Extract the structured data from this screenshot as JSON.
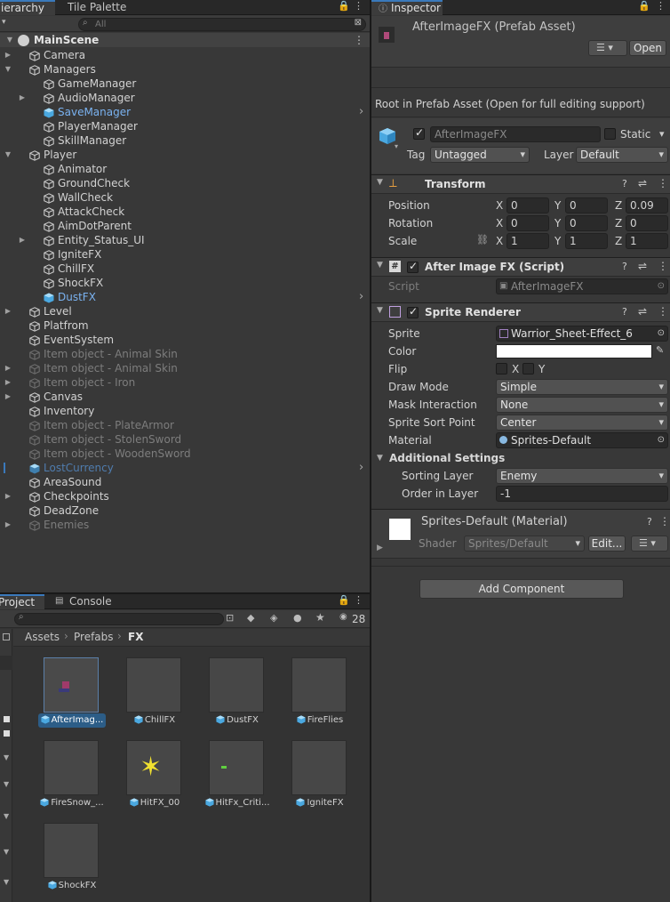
{
  "hierarchy": {
    "tabs": [
      "Hierarchy",
      "Tile Palette"
    ],
    "search_placeholder": "All",
    "scene": "MainScene",
    "items": [
      {
        "label": "Camera",
        "depth": 1,
        "fold": "closed",
        "style": "normal"
      },
      {
        "label": "Managers",
        "depth": 1,
        "fold": "open",
        "style": "normal"
      },
      {
        "label": "GameManager",
        "depth": 2,
        "fold": "none",
        "style": "normal"
      },
      {
        "label": "AudioManager",
        "depth": 2,
        "fold": "closed",
        "style": "normal"
      },
      {
        "label": "SaveManager",
        "depth": 2,
        "fold": "none",
        "style": "prefab",
        "arrow": true
      },
      {
        "label": "PlayerManager",
        "depth": 2,
        "fold": "none",
        "style": "normal"
      },
      {
        "label": "SkillManager",
        "depth": 2,
        "fold": "none",
        "style": "normal"
      },
      {
        "label": "Player",
        "depth": 1,
        "fold": "open",
        "style": "normal"
      },
      {
        "label": "Animator",
        "depth": 2,
        "fold": "none",
        "style": "normal"
      },
      {
        "label": "GroundCheck",
        "depth": 2,
        "fold": "none",
        "style": "normal"
      },
      {
        "label": "WallCheck",
        "depth": 2,
        "fold": "none",
        "style": "normal"
      },
      {
        "label": "AttackCheck",
        "depth": 2,
        "fold": "none",
        "style": "normal"
      },
      {
        "label": "AimDotParent",
        "depth": 2,
        "fold": "none",
        "style": "normal"
      },
      {
        "label": "Entity_Status_UI",
        "depth": 2,
        "fold": "closed",
        "style": "normal"
      },
      {
        "label": "IgniteFX",
        "depth": 2,
        "fold": "none",
        "style": "normal"
      },
      {
        "label": "ChillFX",
        "depth": 2,
        "fold": "none",
        "style": "normal"
      },
      {
        "label": "ShockFX",
        "depth": 2,
        "fold": "none",
        "style": "normal"
      },
      {
        "label": "DustFX",
        "depth": 2,
        "fold": "none",
        "style": "prefab",
        "arrow": true
      },
      {
        "label": "Level",
        "depth": 1,
        "fold": "closed",
        "style": "normal"
      },
      {
        "label": "Platfrom",
        "depth": 1,
        "fold": "none",
        "style": "normal"
      },
      {
        "label": "EventSystem",
        "depth": 1,
        "fold": "none",
        "style": "normal"
      },
      {
        "label": "Item object - Animal Skin",
        "depth": 1,
        "fold": "none",
        "style": "dim"
      },
      {
        "label": "Item object - Animal Skin",
        "depth": 1,
        "fold": "closed",
        "style": "dim"
      },
      {
        "label": "Item object - Iron",
        "depth": 1,
        "fold": "closed",
        "style": "dim"
      },
      {
        "label": "Canvas",
        "depth": 1,
        "fold": "closed",
        "style": "normal"
      },
      {
        "label": "Inventory",
        "depth": 1,
        "fold": "none",
        "style": "normal"
      },
      {
        "label": "Item object - PlateArmor",
        "depth": 1,
        "fold": "none",
        "style": "dim"
      },
      {
        "label": "Item object - StolenSword",
        "depth": 1,
        "fold": "none",
        "style": "dim"
      },
      {
        "label": "Item object - WoodenSword",
        "depth": 1,
        "fold": "none",
        "style": "dim"
      },
      {
        "label": "LostCurrency",
        "depth": 1,
        "fold": "none",
        "style": "prefab-dim",
        "arrow": true
      },
      {
        "label": "AreaSound",
        "depth": 1,
        "fold": "none",
        "style": "normal"
      },
      {
        "label": "Checkpoints",
        "depth": 1,
        "fold": "closed",
        "style": "normal"
      },
      {
        "label": "DeadZone",
        "depth": 1,
        "fold": "none",
        "style": "normal"
      },
      {
        "label": "Enemies",
        "depth": 1,
        "fold": "closed",
        "style": "dim"
      }
    ]
  },
  "project": {
    "tabs": [
      "Project",
      "Console"
    ],
    "hidden_count": "28",
    "breadcrumb": [
      "Assets",
      "Prefabs",
      "FX"
    ],
    "assets": [
      {
        "name": "AfterImag...",
        "thumb": "character",
        "selected": true
      },
      {
        "name": "ChillFX",
        "thumb": "empty"
      },
      {
        "name": "DustFX",
        "thumb": "empty"
      },
      {
        "name": "FireFlies",
        "thumb": "empty"
      },
      {
        "name": "FireSnow_...",
        "thumb": "empty"
      },
      {
        "name": "HitFX_00",
        "thumb": "spark"
      },
      {
        "name": "HitFx_Criti...",
        "thumb": "green"
      },
      {
        "name": "IgniteFX",
        "thumb": "empty"
      },
      {
        "name": "ShockFX",
        "thumb": "empty"
      }
    ]
  },
  "inspector": {
    "tab": "Inspector",
    "title": "AfterImageFX (Prefab Asset)",
    "open_button": "Open",
    "root_note": "Root in Prefab Asset (Open for full editing support)",
    "object_name": "AfterImageFX",
    "static_label": "Static",
    "tag_label": "Tag",
    "tag_value": "Untagged",
    "layer_label": "Layer",
    "layer_value": "Default",
    "transform": {
      "title": "Transform",
      "position": {
        "label": "Position",
        "x": "0",
        "y": "0",
        "z": "0.09"
      },
      "rotation": {
        "label": "Rotation",
        "x": "0",
        "y": "0",
        "z": "0"
      },
      "scale": {
        "label": "Scale",
        "x": "1",
        "y": "1",
        "z": "1"
      },
      "axis_x": "X",
      "axis_y": "Y",
      "axis_z": "Z"
    },
    "script_comp": {
      "title": "After Image FX (Script)",
      "script_label": "Script",
      "script_value": "AfterImageFX"
    },
    "sprite_renderer": {
      "title": "Sprite Renderer",
      "sprite_label": "Sprite",
      "sprite_value": "Warrior_Sheet-Effect_6",
      "color_label": "Color",
      "color_value": "#ffffff",
      "flip_label": "Flip",
      "flip_x": "X",
      "flip_y": "Y",
      "draw_mode_label": "Draw Mode",
      "draw_mode_value": "Simple",
      "mask_label": "Mask Interaction",
      "mask_value": "None",
      "sort_point_label": "Sprite Sort Point",
      "sort_point_value": "Center",
      "material_label": "Material",
      "material_value": "Sprites-Default",
      "additional": "Additional Settings",
      "sorting_layer_label": "Sorting Layer",
      "sorting_layer_value": "Enemy",
      "order_label": "Order in Layer",
      "order_value": "-1"
    },
    "material": {
      "title": "Sprites-Default (Material)",
      "shader_label": "Shader",
      "shader_value": "Sprites/Default",
      "edit_button": "Edit..."
    },
    "add_component": "Add Component"
  }
}
